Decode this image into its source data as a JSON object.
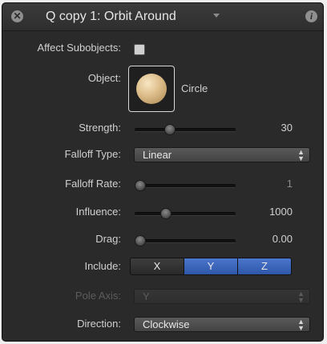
{
  "header": {
    "title": "Q copy 1: Orbit Around",
    "close_icon": "close-icon",
    "info_icon": "info-icon"
  },
  "affect_subobjects": {
    "label": "Affect Subobjects:",
    "checked": false
  },
  "object": {
    "label": "Object:",
    "name": "Circle"
  },
  "strength": {
    "label": "Strength:",
    "value": "30",
    "fraction": 0.33
  },
  "falloff_type": {
    "label": "Falloff Type:",
    "selected": "Linear"
  },
  "falloff_rate": {
    "label": "Falloff Rate:",
    "value": "1",
    "fraction": 0.0
  },
  "influence": {
    "label": "Influence:",
    "value": "1000",
    "fraction": 0.29
  },
  "drag": {
    "label": "Drag:",
    "value": "0.00",
    "fraction": 0.0
  },
  "include": {
    "label": "Include:",
    "options": [
      "X",
      "Y",
      "Z"
    ],
    "active": [
      "Y",
      "Z"
    ]
  },
  "pole_axis": {
    "label": "Pole Axis:",
    "selected": "Y",
    "disabled": true
  },
  "direction": {
    "label": "Direction:",
    "selected": "Clockwise"
  },
  "colors": {
    "panel_bg": "#2a2a2a",
    "segment_active": "#3a63b8"
  }
}
